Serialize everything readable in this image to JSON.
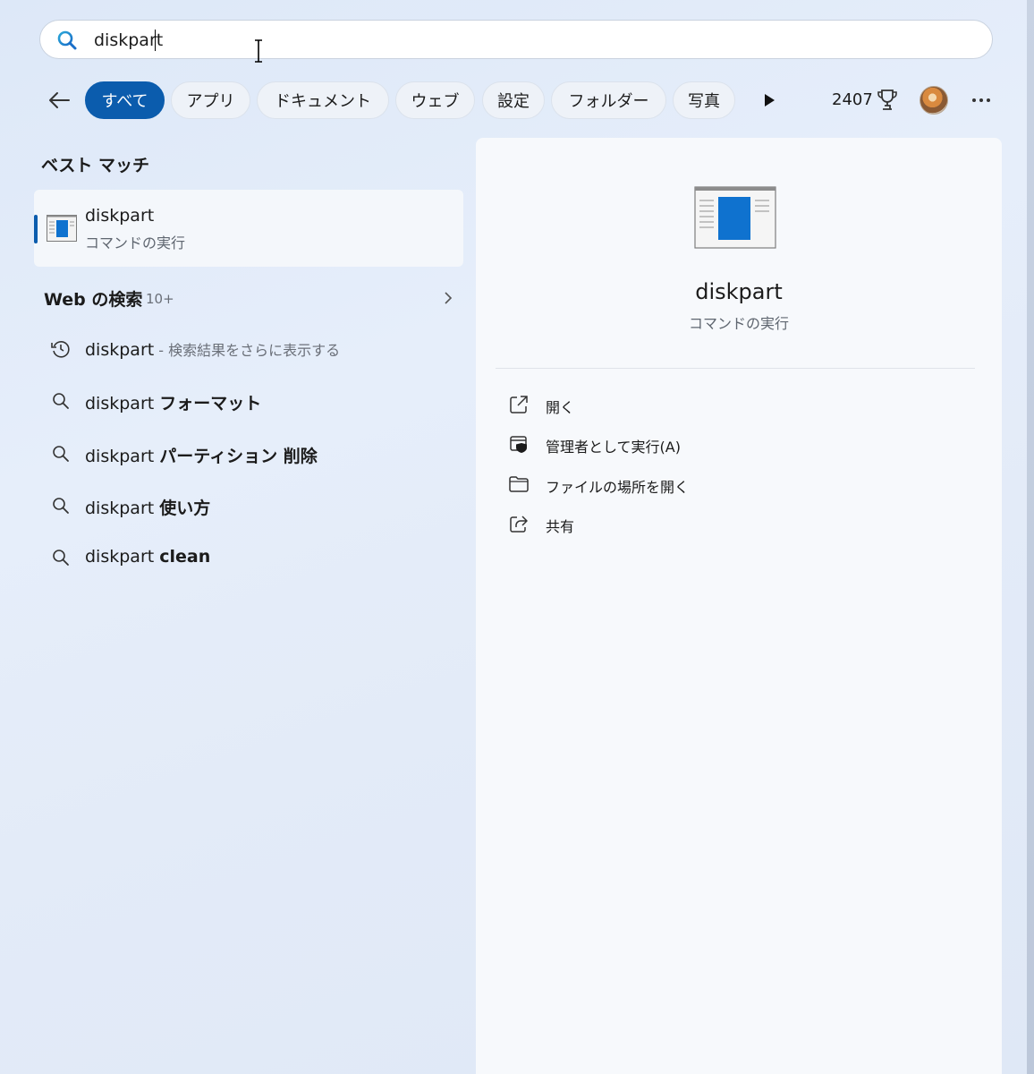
{
  "search": {
    "query": "diskpart"
  },
  "filters": {
    "chips": [
      {
        "label": "すべて",
        "active": true
      },
      {
        "label": "アプリ"
      },
      {
        "label": "ドキュメント"
      },
      {
        "label": "ウェブ"
      },
      {
        "label": "設定"
      },
      {
        "label": "フォルダー"
      },
      {
        "label": "写真"
      }
    ],
    "points": "2407"
  },
  "best_match": {
    "title": "ベスト マッチ",
    "name": "diskpart",
    "sub": "コマンドの実行"
  },
  "web": {
    "title": "Web の検索",
    "count": "10+",
    "items": [
      {
        "prefix": "diskpart",
        "suffix": " - 検索結果をさらに表示する",
        "icon": "history-icon"
      },
      {
        "prefix": "diskpart ",
        "suffix": "フォーマット",
        "icon": "search-icon"
      },
      {
        "prefix": "diskpart ",
        "suffix": "パーティション 削除",
        "icon": "search-icon"
      },
      {
        "prefix": "diskpart ",
        "suffix": "使い方",
        "icon": "search-icon"
      },
      {
        "prefix": "diskpart ",
        "suffix": "clean",
        "icon": "search-icon"
      }
    ]
  },
  "detail": {
    "name": "diskpart",
    "sub": "コマンドの実行",
    "actions": [
      {
        "label": "開く",
        "icon": "open-external-icon"
      },
      {
        "label": "管理者として実行(A)",
        "icon": "shield-window-icon"
      },
      {
        "label": "ファイルの場所を開く",
        "icon": "folder-icon"
      },
      {
        "label": "共有",
        "icon": "share-icon"
      }
    ]
  },
  "colors": {
    "accent": "#0b5cad",
    "panel": "#f7f9fc"
  }
}
